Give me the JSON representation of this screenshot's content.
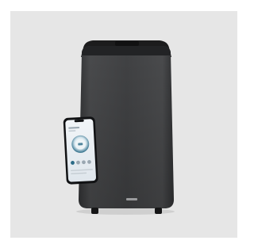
{
  "photo": {
    "background_color": "#e6e6e6",
    "product_color": "#3f4042",
    "product_top_color": "#1c1c1d",
    "brand_mark": "tcl"
  },
  "phone": {
    "screen_color": "#e8edf2",
    "accent_color": "#2a6a86"
  }
}
